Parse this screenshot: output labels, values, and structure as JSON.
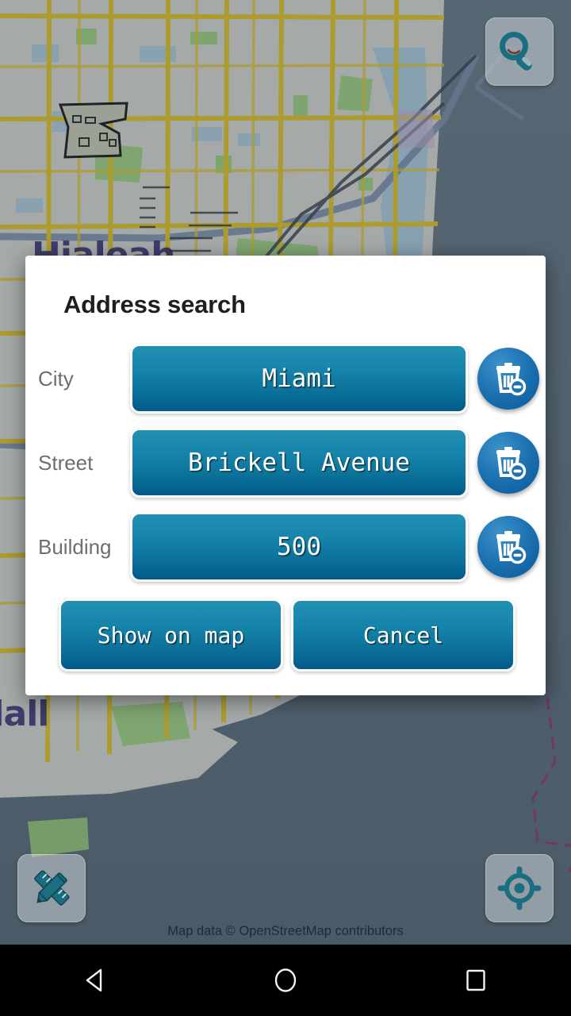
{
  "dialog": {
    "title": "Address search",
    "fields": [
      {
        "label": "City",
        "value": "Miami",
        "clear_icon": "trash-minus-icon"
      },
      {
        "label": "Street",
        "value": "Brickell Avenue",
        "clear_icon": "trash-minus-icon"
      },
      {
        "label": "Building",
        "value": "500",
        "clear_icon": "trash-minus-icon"
      }
    ],
    "actions": [
      {
        "label": "Show on map",
        "name": "show-on-map-button"
      },
      {
        "label": "Cancel",
        "name": "cancel-button"
      }
    ]
  },
  "map": {
    "labels": [
      {
        "text": "Hialeah"
      },
      {
        "text": "dall"
      }
    ],
    "attribution": "Map data © OpenStreetMap contributors",
    "buttons": [
      {
        "name": "map-search-button",
        "icon": "search-icon"
      },
      {
        "name": "map-measure-button",
        "icon": "ruler-pencil-icon"
      },
      {
        "name": "map-locate-button",
        "icon": "gps-locate-icon"
      }
    ]
  },
  "navbar": {
    "keys": [
      {
        "name": "nav-back-button",
        "icon": "back-triangle-icon"
      },
      {
        "name": "nav-home-button",
        "icon": "home-circle-icon"
      },
      {
        "name": "nav-recents-button",
        "icon": "recents-square-icon"
      }
    ]
  },
  "colors": {
    "accent": "#1785ab",
    "accent_dark": "#03598a",
    "clear_button": "#1d72b2",
    "map_water": "#5b6b78",
    "map_land": "#dcdcd6",
    "map_road": "#e8c828",
    "map_green": "#9ed37a",
    "map_label": "#2a2a60",
    "dialog_bg": "#ffffff",
    "label_gray": "#6e6e6e",
    "boundary": "#a0305a",
    "icon_teal": "#1a6e80"
  }
}
